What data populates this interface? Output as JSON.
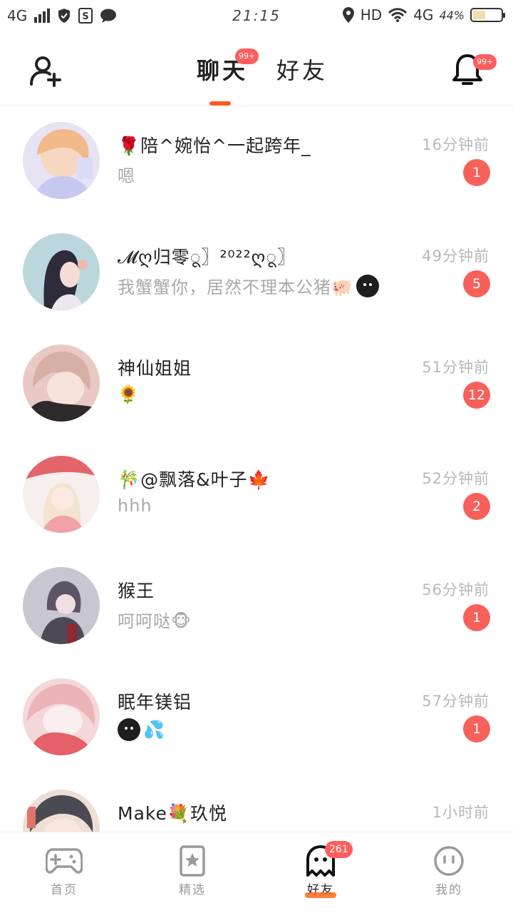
{
  "status_bar": {
    "network": "4G",
    "time": "21:15",
    "hd": "HD",
    "net_right": "4G",
    "battery": "44%",
    "battery_level": 0.44
  },
  "header": {
    "tabs": [
      {
        "label": "聊天",
        "badge": "99+",
        "active": true
      },
      {
        "label": "好友",
        "active": false
      }
    ],
    "bell_badge": "99+"
  },
  "chats": [
    {
      "name": "🌹陪^婉怡^一起跨年_",
      "message": "嗯",
      "time": "16分钟前",
      "unread": "1"
    },
    {
      "name": "𝓜ღ归零ू〗²⁰²²ღू〗",
      "message": "我蟹蟹你，居然不理本公猪🐖",
      "message_extra": "dark-face",
      "time": "49分钟前",
      "unread": "5"
    },
    {
      "name": "神仙姐姐",
      "message": "🌻",
      "time": "51分钟前",
      "unread": "12"
    },
    {
      "name": "🎋@飘落&叶子🍁",
      "message": "hhh",
      "time": "52分钟前",
      "unread": "2"
    },
    {
      "name": "猴王",
      "message": "呵呵哒🐵",
      "time": "56分钟前",
      "unread": "1"
    },
    {
      "name": "眠年镁铝",
      "message": "💦",
      "message_extra": "dark-face-first",
      "time": "57分钟前",
      "unread": "1"
    },
    {
      "name": "Make💐玖悦",
      "message": "",
      "time": "1小时前",
      "unread": ""
    }
  ],
  "bottom_nav": [
    {
      "label": "首页",
      "icon": "gamepad-icon"
    },
    {
      "label": "精选",
      "icon": "star-bookmark-icon"
    },
    {
      "label": "好友",
      "icon": "ghost-icon",
      "badge": "261",
      "active": true
    },
    {
      "label": "我的",
      "icon": "face-icon"
    }
  ],
  "colors": {
    "accent": "#ff5a1f",
    "badge": "#f8605a",
    "muted_text": "#a9a9a9"
  }
}
